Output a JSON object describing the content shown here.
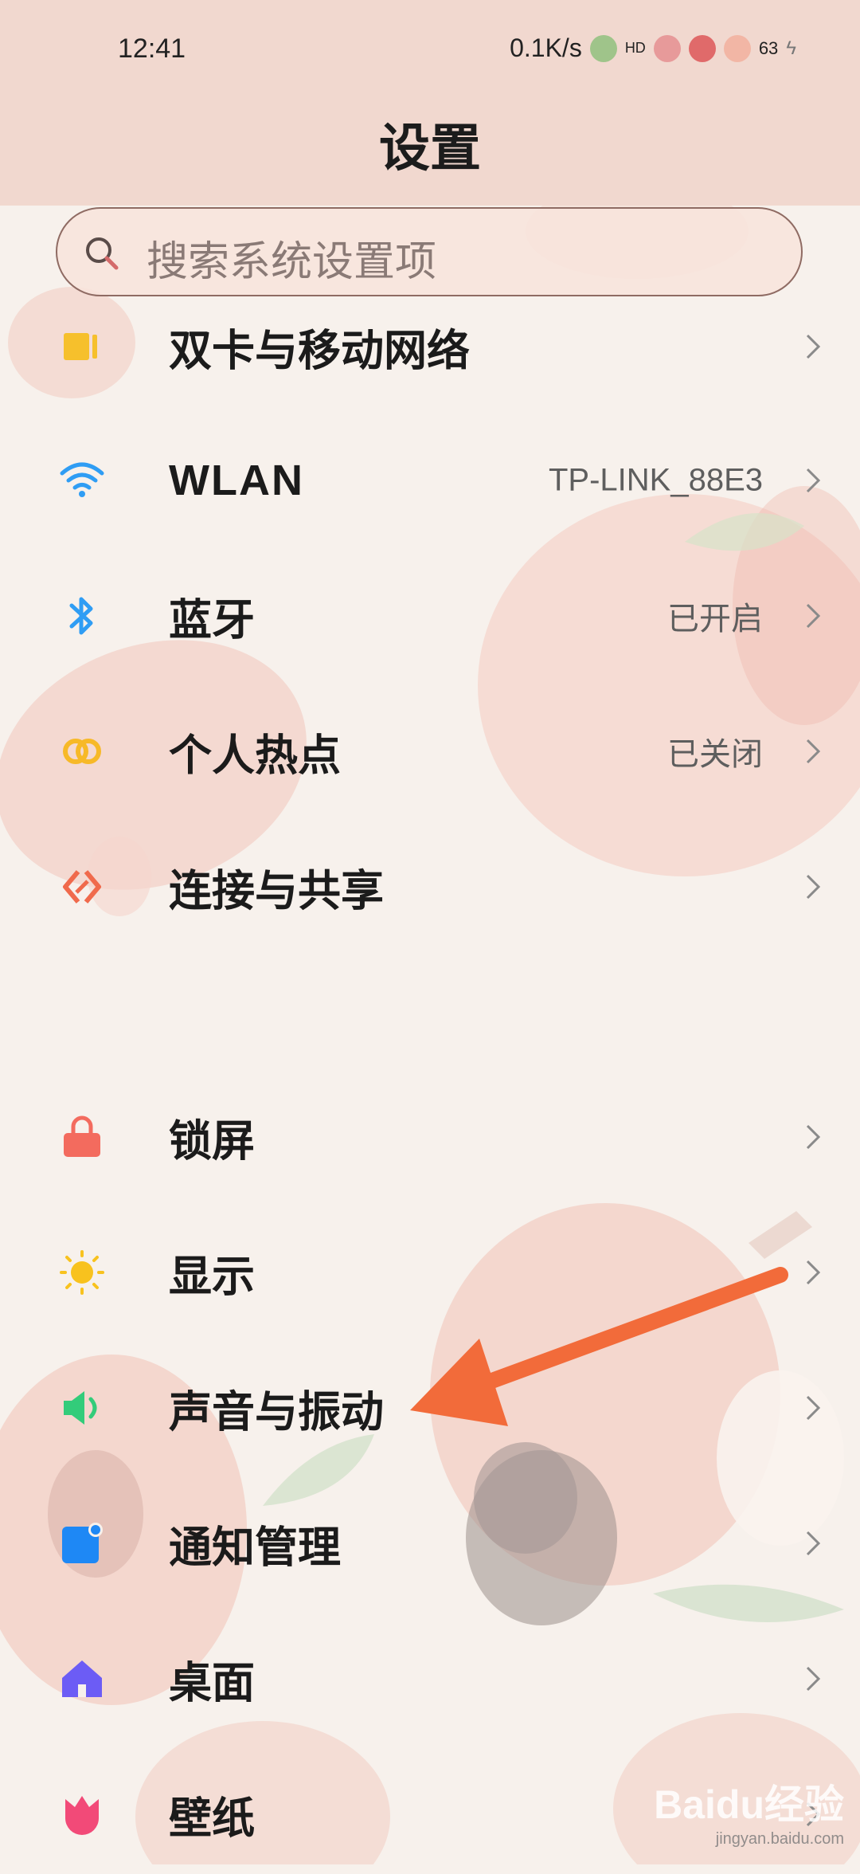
{
  "status_bar": {
    "time": "12:41",
    "net_speed": "0.1K/s",
    "badge": "HD",
    "battery": "63"
  },
  "header": {
    "title": "设置"
  },
  "search": {
    "placeholder": "搜索系统设置项"
  },
  "items": [
    {
      "label": "双卡与移动网络",
      "value": "",
      "icon": "sim-card-icon",
      "color": "#f6c02c"
    },
    {
      "label": "WLAN",
      "value": "TP-LINK_88E3",
      "icon": "wifi-icon",
      "color": "#2f9df4"
    },
    {
      "label": "蓝牙",
      "value": "已开启",
      "icon": "bluetooth-icon",
      "color": "#2f9df4"
    },
    {
      "label": "个人热点",
      "value": "已关闭",
      "icon": "hotspot-icon",
      "color": "#f7b928"
    },
    {
      "label": "连接与共享",
      "value": "",
      "icon": "share-icon",
      "color": "#f06a4c"
    },
    {
      "label": "锁屏",
      "value": "",
      "icon": "lock-icon",
      "color": "#f36b5e"
    },
    {
      "label": "显示",
      "value": "",
      "icon": "sun-icon",
      "color": "#f8c21e"
    },
    {
      "label": "声音与振动",
      "value": "",
      "icon": "speaker-icon",
      "color": "#33cc7a"
    },
    {
      "label": "通知管理",
      "value": "",
      "icon": "notification-icon",
      "color": "#1e88f5"
    },
    {
      "label": "桌面",
      "value": "",
      "icon": "home-icon",
      "color": "#6c5cf5"
    },
    {
      "label": "壁纸",
      "value": "",
      "icon": "tulip-icon",
      "color": "#f24a78"
    }
  ],
  "watermark": {
    "main": "Baidu经验",
    "sub": "jingyan.baidu.com"
  }
}
